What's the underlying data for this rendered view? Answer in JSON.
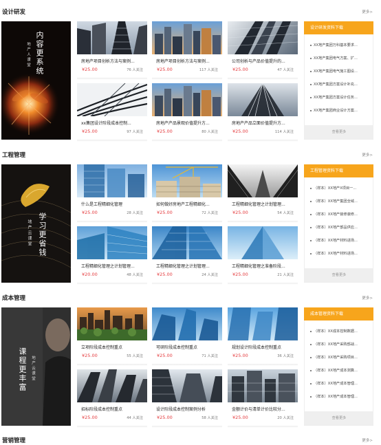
{
  "sections": [
    {
      "title": "设计研发",
      "more": "更多>",
      "banner": {
        "main": "内容更系统",
        "sub": "地产人课堂"
      },
      "cards": [
        {
          "title": "房地产项目创析方法与案例...",
          "price": "¥25.00",
          "follow": "76 人关注"
        },
        {
          "title": "房地产项目创析方法与案例...",
          "price": "¥25.00",
          "follow": "117 人关注"
        },
        {
          "title": "公司创析与产品价值提升的...",
          "price": "¥25.00",
          "follow": "47 人关注"
        },
        {
          "title": "xx集团设计阶段成本控制...",
          "price": "¥25.00",
          "follow": "97 人关注"
        },
        {
          "title": "房地产产品景观价值提升方...",
          "price": "¥25.00",
          "follow": "80 人关注"
        },
        {
          "title": "房地产产品立面价值提升方...",
          "price": "¥25.00",
          "follow": "114 人关注"
        }
      ],
      "download": {
        "header": "设计研发资料下载",
        "items": [
          "XX地产集团万科基本要求...",
          "XX地产集团电气方案、扩...",
          "XX地产集团电气施工图设...",
          "XX地产集团方案设计补充...",
          "XX地产集团方案设计任务...",
          "XX地产集团商业设计方案..."
        ],
        "button": "查看更多"
      }
    },
    {
      "title": "工程管理",
      "more": "更多>",
      "banner": {
        "main": "学习更省钱",
        "sub": "地产云课堂"
      },
      "cards": [
        {
          "title": "什么是工程精细化管理",
          "price": "¥25.00",
          "follow": "28 人关注"
        },
        {
          "title": "如何做好房地产工程精细化...",
          "price": "¥25.00",
          "follow": "72 人关注"
        },
        {
          "title": "工程精细化管理之计划管理...",
          "price": "¥25.00",
          "follow": "54 人关注"
        },
        {
          "title": "工程精细化管理之计划管理...",
          "price": "¥20.00",
          "follow": "48 人关注"
        },
        {
          "title": "工程精细化管理之计划管理...",
          "price": "¥25.00",
          "follow": "24 人关注"
        },
        {
          "title": "工程精细化管理之准备阶段...",
          "price": "¥25.00",
          "follow": "21 人关注"
        }
      ],
      "download": {
        "header": "工程管理资料下载",
        "items": [
          "（样本）XX地产X项目一...",
          "（样本）XX地产集团全域...",
          "（样本）XX地产装修装修...",
          "（样本）XX地产部品供应...",
          "（样本）XX地产材料进场...",
          "（样本）XX地产材料进场..."
        ],
        "button": "查看更多"
      }
    },
    {
      "title": "成本管理",
      "more": "更多>",
      "banner": {
        "main": "课程更丰富",
        "sub": "地产云课堂"
      },
      "cards": [
        {
          "title": "立项阶段成本控制重点",
          "price": "¥25.00",
          "follow": "55 人关注"
        },
        {
          "title": "可研阶段成本控制重点",
          "price": "¥25.00",
          "follow": "71 人关注"
        },
        {
          "title": "规划设计阶段成本控制重点",
          "price": "¥25.00",
          "follow": "36 人关注"
        },
        {
          "title": "招标阶段成本控制重点",
          "price": "¥25.00",
          "follow": "44 人关注"
        },
        {
          "title": "设计阶段成本控制案例分析",
          "price": "¥25.00",
          "follow": "58 人关注"
        },
        {
          "title": "金额计价与清单计价比较分...",
          "price": "¥25.00",
          "follow": "20 人关注"
        }
      ],
      "download": {
        "header": "成本管理资料下载",
        "items": [
          "（样本）XX成本控制数据...",
          "（样本）XX地产采购部战...",
          "（样本）XX地产采购项目...",
          "（样本）XX地产成本测算...",
          "（样本）XX地产成本管理...",
          "（样本）XX地产成本管理..."
        ],
        "button": "查看更多"
      }
    }
  ],
  "next_section": {
    "title": "营销管理",
    "more": "更多>"
  }
}
